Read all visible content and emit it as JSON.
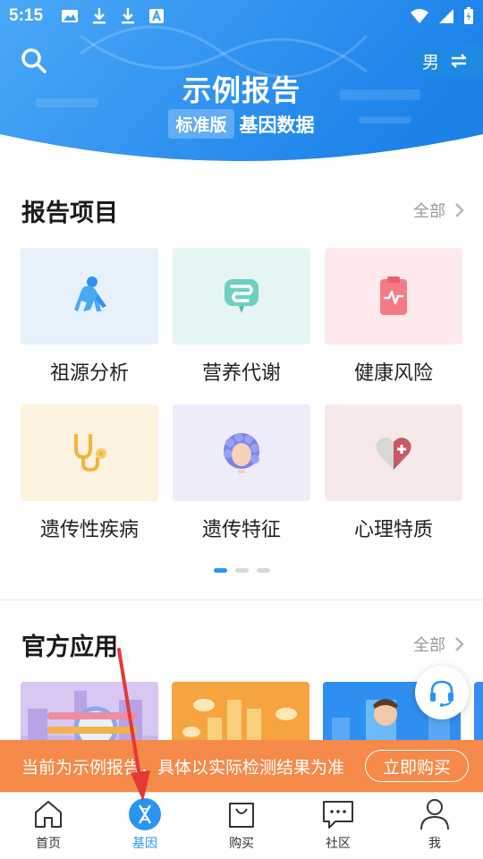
{
  "status_bar": {
    "time": "5:15",
    "left_icons": [
      "image-icon",
      "download-icon",
      "download-icon",
      "font-icon"
    ],
    "right_icons": [
      "wifi-icon",
      "signal-icon",
      "battery-charging-icon"
    ]
  },
  "header": {
    "title": "示例报告",
    "badge": "标准版",
    "subtitle": "基因数据",
    "gender": "男",
    "colors": {
      "gradient_start": "#4aa8f7",
      "gradient_end": "#1c82ea"
    }
  },
  "report_section": {
    "title": "报告项目",
    "see_all": "全部",
    "items": [
      {
        "label": "祖源分析",
        "icon": "ape-icon",
        "tile_color": "#e6f1fb"
      },
      {
        "label": "营养代谢",
        "icon": "stomach-icon",
        "tile_color": "#e5f5f3"
      },
      {
        "label": "健康风险",
        "icon": "clipboard-heartbeat-icon",
        "tile_color": "#fde9eb"
      },
      {
        "label": "遗传性疾病",
        "icon": "stethoscope-icon",
        "tile_color": "#fbf3e0"
      },
      {
        "label": "遗传特征",
        "icon": "curly-hair-icon",
        "tile_color": "#ececfb"
      },
      {
        "label": "心理特质",
        "icon": "heart-plus-icon",
        "tile_color": "#f7e9ea"
      }
    ],
    "page_dots": 3,
    "active_dot": 0
  },
  "apps_section": {
    "title": "官方应用",
    "see_all": "全部",
    "cards": [
      "dna-magnifier-card",
      "cloud-graph-card",
      "doctor-screen-card"
    ]
  },
  "banner": {
    "text": "当前为示例报告，具体以实际检测结果为准",
    "button": "立即购买"
  },
  "tabs": [
    {
      "label": "首页",
      "icon": "home-icon",
      "active": false
    },
    {
      "label": "基因",
      "icon": "dna-icon",
      "active": true
    },
    {
      "label": "购买",
      "icon": "shopping-bag-icon",
      "active": false
    },
    {
      "label": "社区",
      "icon": "chat-icon",
      "active": false
    },
    {
      "label": "我",
      "icon": "user-icon",
      "active": false
    }
  ],
  "annotation_color": "#e53935"
}
